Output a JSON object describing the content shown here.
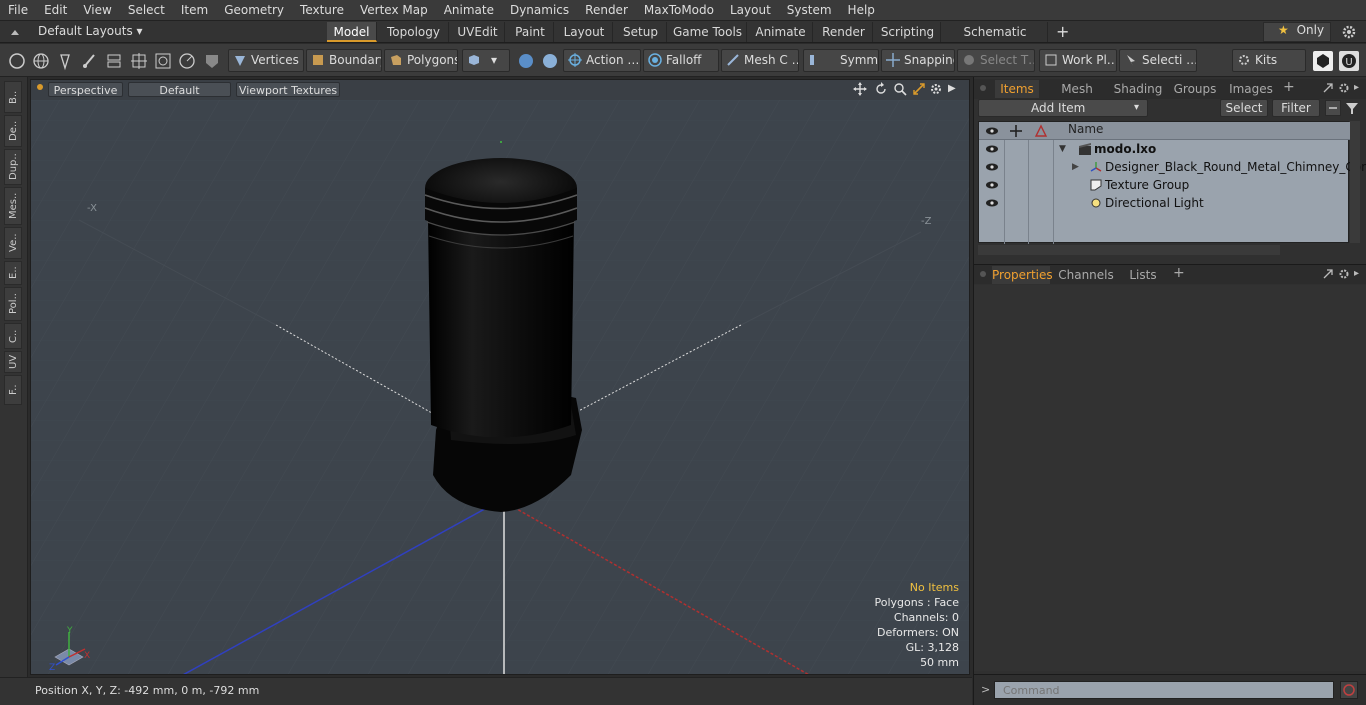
{
  "menu": [
    "File",
    "Edit",
    "View",
    "Select",
    "Item",
    "Geometry",
    "Texture",
    "Vertex Map",
    "Animate",
    "Dynamics",
    "Render",
    "MaxToModo",
    "Layout",
    "System",
    "Help"
  ],
  "layout_selector": "Default Layouts ▾",
  "layout_tabs": [
    "Model",
    "Topology",
    "UVEdit",
    "Paint",
    "Layout",
    "Setup",
    "Game Tools",
    "Animate",
    "Render",
    "Scripting",
    "Schematic Fusion"
  ],
  "active_layout_tab": "Model",
  "only_label": "Only",
  "toolbar": {
    "vertices": "Vertices",
    "boundary": "Boundary",
    "polygons": "Polygons",
    "action": "Action",
    "action_more": "…",
    "falloff": "Falloff",
    "mesh": "Mesh C …",
    "symm": "Symm …",
    "snapping": "Snapping",
    "select_t": "Select T…",
    "workplane": "Work Pl…",
    "selection": "Selecti …",
    "kits": "Kits"
  },
  "left_tabs": [
    "B..",
    "De..",
    "Dup..",
    "Mes..",
    "Ve..",
    "E..",
    "Pol..",
    "C..",
    "UV",
    "F.."
  ],
  "viewport": {
    "view_mode": "Perspective",
    "shading": "Default",
    "textures": "Viewport Textures",
    "axis_labels": {
      "x": "X",
      "y": "Y",
      "z": "Z",
      "neg_x": "-X",
      "neg_z": "-Z"
    },
    "stats": {
      "items": "No Items",
      "polygons": "Polygons : Face",
      "channels": "Channels: 0",
      "deformers": "Deformers: ON",
      "gl": "GL: 3,128",
      "scale": "50 mm"
    }
  },
  "status": {
    "position": "Position X, Y, Z:  -492 mm, 0 m, -792 mm"
  },
  "items_panel": {
    "tabs": [
      "Items",
      "Mesh Ops",
      "Shading",
      "Groups",
      "Images"
    ],
    "active_tab": "Items",
    "add_item": "Add Item",
    "select": "Select",
    "filter": "Filter",
    "name_header": "Name",
    "rows": [
      {
        "label": "modo.lxo",
        "bold": true
      },
      {
        "label": "Designer_Black_Round_Metal_Chimney_Corner …",
        "bold": false
      },
      {
        "label": "Texture Group",
        "bold": false
      },
      {
        "label": "Directional Light",
        "bold": false
      }
    ]
  },
  "properties_panel": {
    "tabs": [
      "Properties",
      "Channels",
      "Lists"
    ],
    "active_tab": "Properties"
  },
  "command": {
    "placeholder": "Command"
  },
  "colors": {
    "accent": "#d99a2b",
    "x_axis": "#b03030",
    "y_axis": "#40a040",
    "z_axis": "#3040c0"
  }
}
